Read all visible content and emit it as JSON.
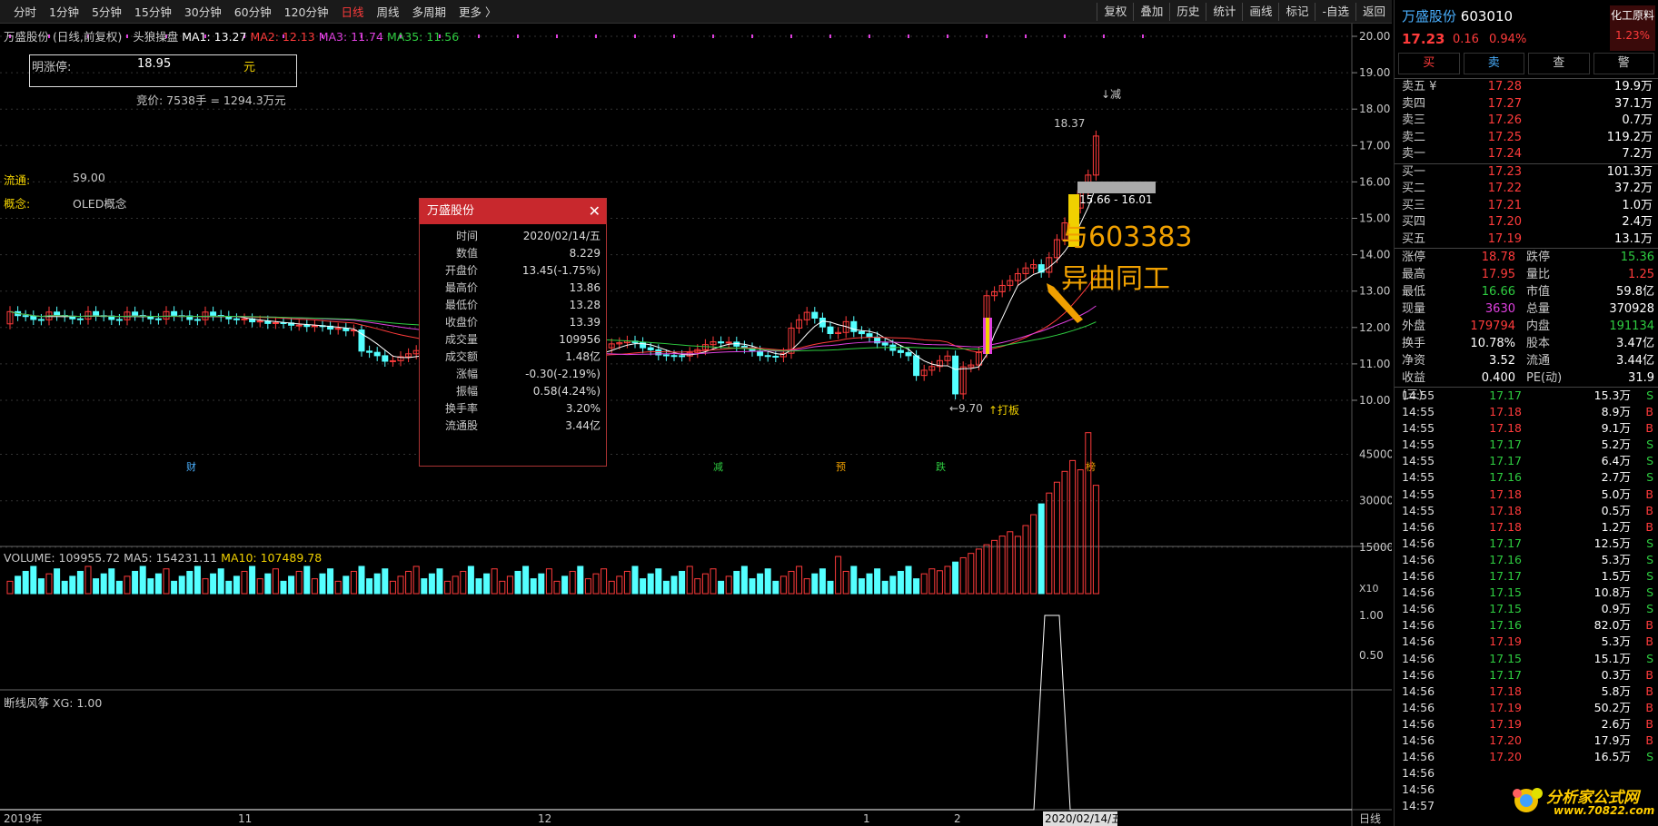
{
  "colors": {
    "up": "#ff3b3b",
    "down": "#54ffff",
    "ma1": "#ffffff",
    "ma2": "#ff3b3b",
    "ma3": "#e040e0",
    "ma35": "#2ecc40"
  },
  "toolbar": {
    "periods": [
      "分时",
      "1分钟",
      "5分钟",
      "15分钟",
      "30分钟",
      "60分钟",
      "120分钟",
      "日线",
      "周线",
      "多周期",
      "更多 〉"
    ],
    "active": "日线",
    "right": [
      "复权",
      "叠加",
      "历史",
      "统计",
      "画线",
      "标记",
      "-自选",
      "返回"
    ]
  },
  "chart": {
    "title": "万盛股份 (日线,前复权)",
    "tag": "头狼操盘",
    "ma1": "MA1: 13.27",
    "ma2": "MA2: 12.13",
    "ma3": "MA3: 11.74",
    "ma35": "MA35: 11.56",
    "limit_label": "明涨停:",
    "limit_value": "18.95",
    "limit_unit": "元",
    "bid": "竞价: 7538手 = 1294.3万元",
    "float_label": "流通:",
    "float_value": "59.00",
    "concept_label": "概念:",
    "concept_value": "OLED概念",
    "y_ticks": [
      "20.00",
      "19.00",
      "18.00",
      "17.00",
      "16.00",
      "15.00",
      "14.00",
      "13.00",
      "12.00",
      "11.00",
      "10.00"
    ],
    "hi_label": "18.37",
    "lo_label": "9.70",
    "jian": "↓减",
    "daban": "↑打板",
    "range_label": "15.66 - 16.01",
    "annot1": "与603383",
    "annot2": "异曲同工",
    "events": [
      "财",
      "减",
      "预",
      "跌",
      "榜"
    ]
  },
  "popup": {
    "title": "万盛股份",
    "rows": [
      [
        "时间",
        "2020/02/14/五"
      ],
      [
        "数值",
        "8.229"
      ],
      [
        "开盘价",
        "13.45(-1.75%)"
      ],
      [
        "最高价",
        "13.86"
      ],
      [
        "最低价",
        "13.28"
      ],
      [
        "收盘价",
        "13.39"
      ],
      [
        "成交量",
        "109956"
      ],
      [
        "成交额",
        "1.48亿"
      ],
      [
        "涨幅",
        "-0.30(-2.19%)"
      ],
      [
        "振幅",
        "0.58(4.24%)"
      ],
      [
        "换手率",
        "3.20%"
      ],
      [
        "流通股",
        "3.44亿"
      ]
    ]
  },
  "volume": {
    "title": "VOLUME: 109955.72",
    "ma5": "MA5: 154231.11",
    "ma10": "MA10: 107489.78",
    "y_ticks": [
      "45000",
      "30000",
      "15000"
    ],
    "unit": "X10"
  },
  "indicator": {
    "title": "断线风筝",
    "xg": "XG: 1.00",
    "y_ticks": [
      "1.00",
      "0.50"
    ]
  },
  "xaxis": {
    "labels": [
      "2019年",
      "11",
      "12",
      "1",
      "2"
    ],
    "cursor": "2020/02/14/五",
    "period": "日线"
  },
  "quote": {
    "name": "万盛股份",
    "code": "603010",
    "sector": "化工原料",
    "sector_pct": "1.23%",
    "price": "17.23",
    "change": "0.16",
    "pct": "0.94%",
    "tabs": [
      "买",
      "卖",
      "查",
      "警"
    ]
  },
  "orderbook": {
    "asks": [
      [
        "卖五 ¥",
        "17.28",
        "19.9万"
      ],
      [
        "卖四",
        "17.27",
        "37.1万"
      ],
      [
        "卖三",
        "17.26",
        "0.7万"
      ],
      [
        "卖二",
        "17.25",
        "119.2万"
      ],
      [
        "卖一",
        "17.24",
        "7.2万"
      ]
    ],
    "bids": [
      [
        "买一",
        "17.23",
        "101.3万"
      ],
      [
        "买二",
        "17.22",
        "37.2万"
      ],
      [
        "买三",
        "17.21",
        "1.0万"
      ],
      [
        "买四",
        "17.20",
        "2.4万"
      ],
      [
        "买五",
        "17.19",
        "13.1万"
      ]
    ]
  },
  "stats": [
    [
      "涨停",
      "18.78",
      "跌停",
      "15.36"
    ],
    [
      "最高",
      "17.95",
      "量比",
      "1.25"
    ],
    [
      "最低",
      "16.66",
      "市值",
      "59.8亿"
    ],
    [
      "现量",
      "3630",
      "总量",
      "370928"
    ],
    [
      "外盘",
      "179794",
      "内盘",
      "191134"
    ],
    [
      "换手",
      "10.78%",
      "股本",
      "3.47亿"
    ],
    [
      "净资",
      "3.52",
      "流通",
      "3.44亿"
    ],
    [
      "收益(三)",
      "0.400",
      "PE(动)",
      "31.9"
    ]
  ],
  "ticks": [
    [
      "14:55",
      "17.17",
      "15.3万",
      "S"
    ],
    [
      "14:55",
      "17.18",
      "8.9万",
      "B"
    ],
    [
      "14:55",
      "17.18",
      "9.1万",
      "B"
    ],
    [
      "14:55",
      "17.17",
      "5.2万",
      "S"
    ],
    [
      "14:55",
      "17.17",
      "6.4万",
      "S"
    ],
    [
      "14:55",
      "17.16",
      "2.7万",
      "S"
    ],
    [
      "14:55",
      "17.18",
      "5.0万",
      "B"
    ],
    [
      "14:55",
      "17.18",
      "0.5万",
      "B"
    ],
    [
      "14:56",
      "17.18",
      "1.2万",
      "B"
    ],
    [
      "14:56",
      "17.17",
      "12.5万",
      "S"
    ],
    [
      "14:56",
      "17.16",
      "5.3万",
      "S"
    ],
    [
      "14:56",
      "17.17",
      "1.5万",
      "S"
    ],
    [
      "14:56",
      "17.15",
      "10.8万",
      "S"
    ],
    [
      "14:56",
      "17.15",
      "0.9万",
      "S"
    ],
    [
      "14:56",
      "17.16",
      "82.0万",
      "B"
    ],
    [
      "14:56",
      "17.19",
      "5.3万",
      "B"
    ],
    [
      "14:56",
      "17.15",
      "15.1万",
      "S"
    ],
    [
      "14:56",
      "17.17",
      "0.3万",
      "B"
    ],
    [
      "14:56",
      "17.18",
      "5.8万",
      "B"
    ],
    [
      "14:56",
      "17.19",
      "50.2万",
      "B"
    ],
    [
      "14:56",
      "17.19",
      "2.6万",
      "B"
    ],
    [
      "14:56",
      "17.20",
      "17.9万",
      "B"
    ],
    [
      "14:56",
      "17.20",
      "16.5万",
      "S"
    ],
    [
      "14:56",
      "",
      "",
      " "
    ],
    [
      "14:56",
      "",
      "",
      " "
    ],
    [
      "14:57",
      "",
      "",
      " "
    ]
  ],
  "watermark": {
    "name": "分析家公式网",
    "url": "www.70822.com"
  }
}
